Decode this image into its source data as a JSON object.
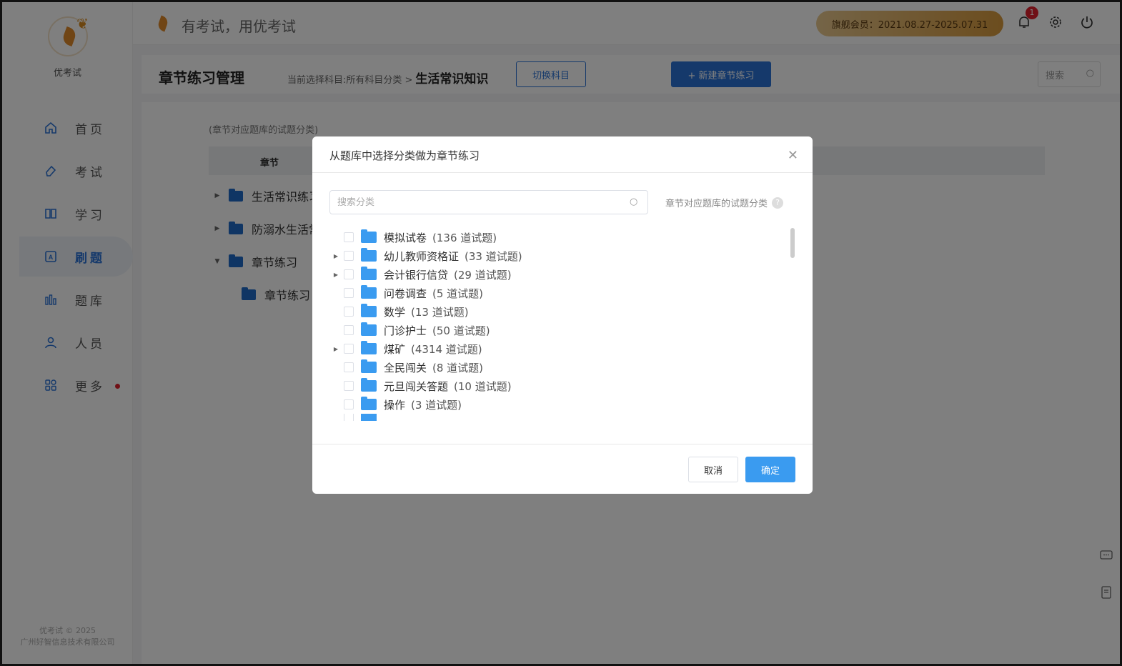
{
  "app": {
    "logo_text": "优考试",
    "slogan": "有考试，用优考试"
  },
  "sidebar": {
    "items": [
      {
        "label": "首页",
        "icon": "home-icon"
      },
      {
        "label": "考试",
        "icon": "eraser-icon"
      },
      {
        "label": "学习",
        "icon": "book-icon"
      },
      {
        "label": "刷题",
        "icon": "quiz-icon"
      },
      {
        "label": "题库",
        "icon": "bars-icon"
      },
      {
        "label": "人员",
        "icon": "user-icon"
      },
      {
        "label": "更多",
        "icon": "grid-icon"
      }
    ],
    "active_index": 3,
    "footer_line1": "优考试 © 2025",
    "footer_line2": "广州好智信息技术有限公司"
  },
  "header": {
    "vip_text": "旗舰会员：2021.08.27-2025.07.31",
    "notification_count": "1"
  },
  "page": {
    "title": "章节练习管理",
    "crumb_prefix": "当前选择科目:所有科目分类 >",
    "crumb_current": "生活常识知识",
    "switch_button": "切换科目",
    "new_button": "+ 新建章节练习",
    "search_placeholder": "搜索",
    "hint": "(章节对应题库的试题分类)",
    "table_header": "章节",
    "tree": [
      {
        "label": "生活常识练习",
        "arrow": "▶"
      },
      {
        "label": "防溺水生活常",
        "arrow": "▶"
      },
      {
        "label": "章节练习",
        "arrow": "▼"
      },
      {
        "label": "章节练习",
        "arrow": ""
      }
    ]
  },
  "modal": {
    "title": "从题库中选择分类做为章节练习",
    "search_placeholder": "搜索分类",
    "note": "章节对应题库的试题分类",
    "items": [
      {
        "name": "模拟试卷",
        "count": "(136  道试题)",
        "expandable": false
      },
      {
        "name": "幼儿教师资格证",
        "count": "(33  道试题)",
        "expandable": true
      },
      {
        "name": "会计银行信贷",
        "count": "(29  道试题)",
        "expandable": true
      },
      {
        "name": "问卷调查",
        "count": "(5  道试题)",
        "expandable": false
      },
      {
        "name": "数学",
        "count": "(13  道试题)",
        "expandable": false
      },
      {
        "name": "门诊护士",
        "count": "(50  道试题)",
        "expandable": false
      },
      {
        "name": "煤矿",
        "count": "(4314  道试题)",
        "expandable": true
      },
      {
        "name": "全民闯关",
        "count": "(8  道试题)",
        "expandable": false
      },
      {
        "name": "元旦闯关答题",
        "count": "(10  道试题)",
        "expandable": false
      },
      {
        "name": "操作",
        "count": "(3  道试题)",
        "expandable": false
      }
    ],
    "cancel": "取消",
    "confirm": "确定"
  }
}
